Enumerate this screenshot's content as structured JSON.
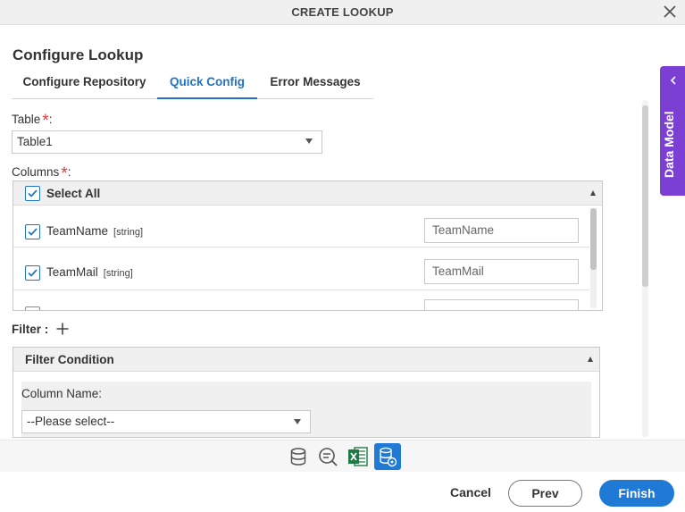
{
  "dialog": {
    "title": "CREATE LOOKUP",
    "heading": "Configure Lookup"
  },
  "tabs": [
    {
      "label": "Configure Repository",
      "active": false
    },
    {
      "label": "Quick Config",
      "active": true
    },
    {
      "label": "Error Messages",
      "active": false
    }
  ],
  "table_field": {
    "label": "Table",
    "required_mark": "*",
    "colon": ":",
    "value": "Table1"
  },
  "columns_field": {
    "label": "Columns",
    "required_mark": "*",
    "colon": ":",
    "select_all_label": "Select All",
    "select_all_checked": true,
    "rows": [
      {
        "name": "TeamName",
        "type": "[string]",
        "checked": true,
        "alias": "TeamName"
      },
      {
        "name": "TeamMail",
        "type": "[string]",
        "checked": true,
        "alias": "TeamMail"
      },
      {
        "name": "",
        "type": "",
        "checked": false,
        "alias": ""
      }
    ]
  },
  "filter": {
    "label": "Filter :",
    "add_icon": "plus-icon",
    "panel_title": "Filter Condition",
    "column_name_label": "Column Name:",
    "column_name_value": "--Please select--"
  },
  "toolbar_icons": [
    {
      "icon": "database-icon",
      "active": false
    },
    {
      "icon": "query-icon",
      "active": false
    },
    {
      "icon": "excel-icon",
      "active": false
    },
    {
      "icon": "database-settings-icon",
      "active": true
    }
  ],
  "footer": {
    "cancel_label": "Cancel",
    "prev_label": "Prev",
    "finish_label": "Finish"
  },
  "side_panel": {
    "label": "Data Model",
    "icon": "chevron-left-icon"
  },
  "colors": {
    "accent": "#1f7ad6",
    "required": "#e53935",
    "side_panel": "#7b3fd4",
    "excel": "#1e7a45"
  }
}
